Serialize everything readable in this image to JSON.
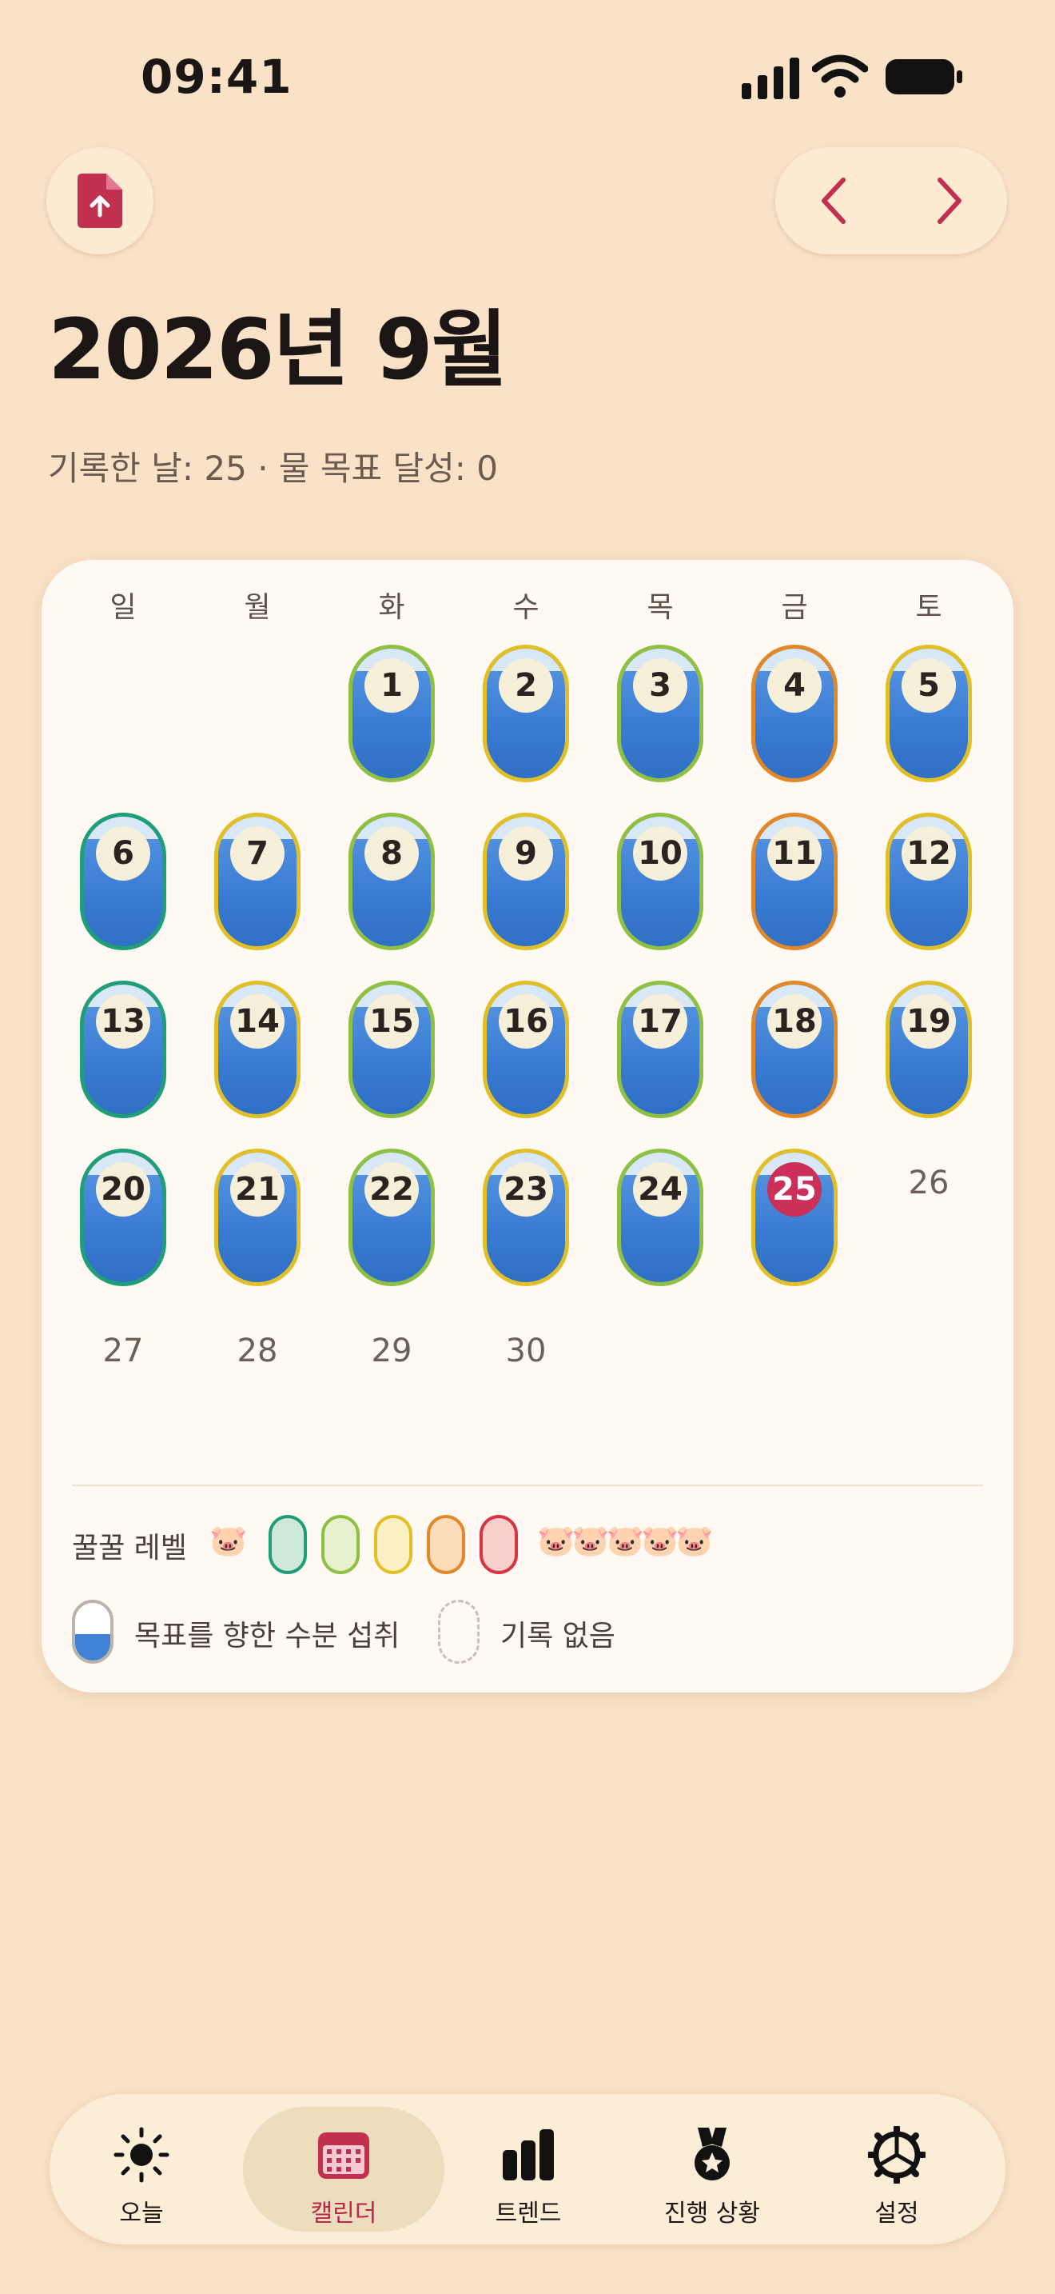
{
  "status_bar": {
    "time": "09:41"
  },
  "header": {
    "title": "2026년 9월",
    "stats": "기록한 날: 25 · 물 목표 달성: 0"
  },
  "calendar": {
    "weekdays": [
      "일",
      "월",
      "화",
      "수",
      "목",
      "금",
      "토"
    ],
    "today": 25,
    "days": [
      {
        "day": 1,
        "level": 2
      },
      {
        "day": 2,
        "level": 3
      },
      {
        "day": 3,
        "level": 2
      },
      {
        "day": 4,
        "level": 4
      },
      {
        "day": 5,
        "level": 3
      },
      {
        "day": 6,
        "level": 1
      },
      {
        "day": 7,
        "level": 3
      },
      {
        "day": 8,
        "level": 2
      },
      {
        "day": 9,
        "level": 3
      },
      {
        "day": 10,
        "level": 2
      },
      {
        "day": 11,
        "level": 4
      },
      {
        "day": 12,
        "level": 3
      },
      {
        "day": 13,
        "level": 1
      },
      {
        "day": 14,
        "level": 3
      },
      {
        "day": 15,
        "level": 2
      },
      {
        "day": 16,
        "level": 3
      },
      {
        "day": 17,
        "level": 2
      },
      {
        "day": 18,
        "level": 4
      },
      {
        "day": 19,
        "level": 3
      },
      {
        "day": 20,
        "level": 1
      },
      {
        "day": 21,
        "level": 3
      },
      {
        "day": 22,
        "level": 2
      },
      {
        "day": 23,
        "level": 3
      },
      {
        "day": 24,
        "level": 2
      },
      {
        "day": 25,
        "level": 3
      },
      {
        "day": 26,
        "level": 0
      },
      {
        "day": 27,
        "level": 0
      },
      {
        "day": 28,
        "level": 0
      },
      {
        "day": 29,
        "level": 0
      },
      {
        "day": 30,
        "level": 0
      }
    ]
  },
  "legend": {
    "level_label": "꿀꿀 레벨",
    "pig": "🐷",
    "pig_row": "🐷🐷🐷🐷🐷",
    "level_colors": [
      {
        "border": "#1f9e78",
        "fill": "#cfe9d9"
      },
      {
        "border": "#8fc044",
        "fill": "#e7f0cf"
      },
      {
        "border": "#e1bf27",
        "fill": "#fbf0c4"
      },
      {
        "border": "#e0882a",
        "fill": "#fbdcb9"
      },
      {
        "border": "#d8353f",
        "fill": "#f8cfcc"
      }
    ],
    "water_label": "목표를 향한 수분 섭취",
    "no_record_label": "기록 없음"
  },
  "tabs": [
    {
      "label": "오늘",
      "icon": "sun-icon"
    },
    {
      "label": "캘린더",
      "icon": "calendar-icon",
      "selected": true
    },
    {
      "label": "트렌드",
      "icon": "bar-chart-icon"
    },
    {
      "label": "진행 상황",
      "icon": "medal-icon"
    },
    {
      "label": "설정",
      "icon": "settings-icon"
    }
  ],
  "colors": {
    "accent": "#c2304f",
    "background": "#F9E2C8",
    "card": "#FFF9F3",
    "water": "#3a7cd3"
  }
}
